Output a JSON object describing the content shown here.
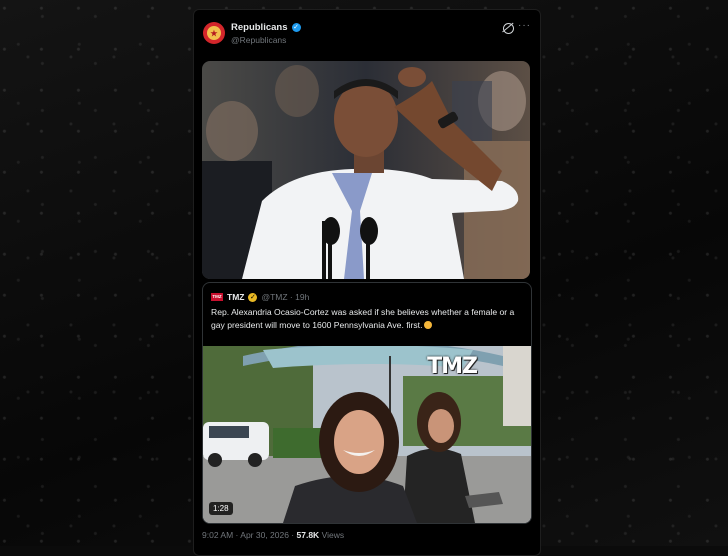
{
  "post": {
    "display_name": "Republicans",
    "handle": "@Republicans",
    "verified_mark": "✓",
    "avatar_mark": "★",
    "more_label": "···",
    "icons": [
      "grok-icon",
      "more-icon",
      "verified-badge-icon"
    ]
  },
  "quote": {
    "logo_text": "TMZ",
    "name": "TMZ",
    "verified_mark": "✓",
    "handle_time": "@TMZ · 19h",
    "text": "Rep. Alexandria Ocasio-Cortez was asked if she believes whether a female or a gay president will move to 1600 Pennsylvania Ave. first.",
    "video_duration": "1:28",
    "watermark": "TMZ"
  },
  "meta": {
    "timestamp": "9:02 AM · Apr 30, 2026 · ",
    "views_count": "57.8K",
    "views_label": " Views"
  },
  "colors": {
    "accent_blue": "#1d9bf0",
    "tmz_red": "#c8102e",
    "gold_badge": "#e8b824"
  }
}
